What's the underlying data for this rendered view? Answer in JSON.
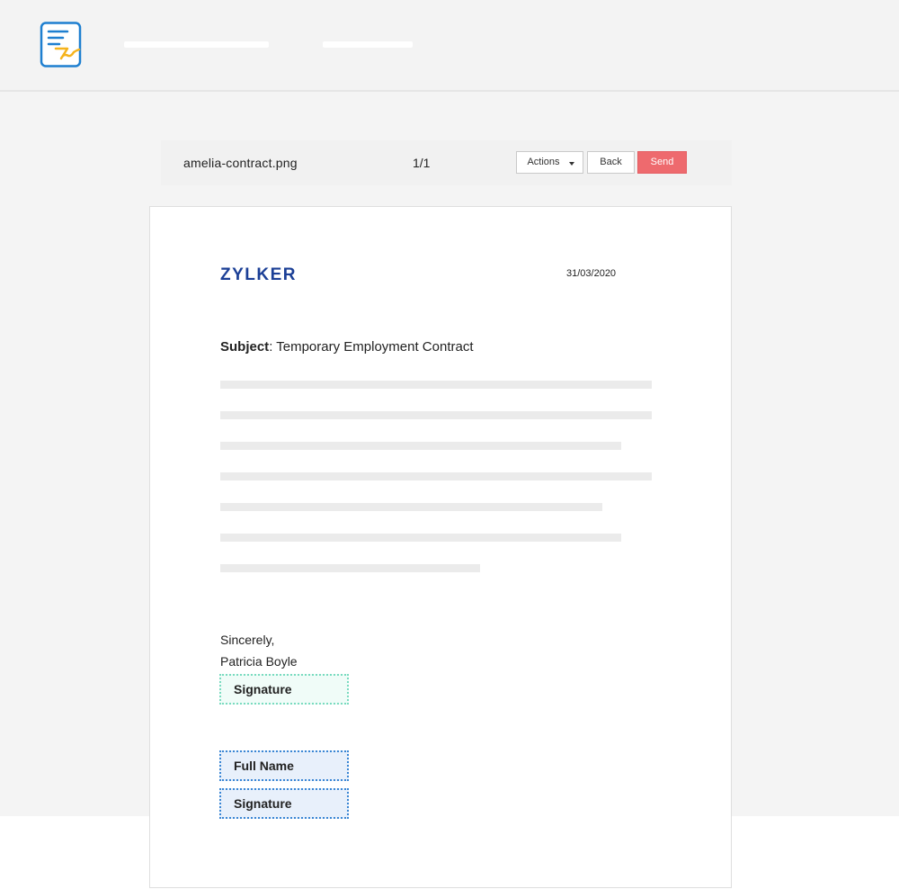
{
  "toolbar": {
    "filename": "amelia-contract.png",
    "page_count": "1/1",
    "actions_label": "Actions",
    "back_label": "Back",
    "send_label": "Send"
  },
  "document": {
    "company": "ZYLKER",
    "date": "31/03/2020",
    "subject_label": "Subject",
    "subject_value": ": Temporary Employment Contract",
    "closing": "Sincerely,",
    "sender_name": "Patricia Boyle"
  },
  "fields": {
    "sender_signature": "Signature",
    "recipient_full_name": "Full Name",
    "recipient_signature": "Signature"
  },
  "icons": {
    "logo": "document-signature-icon",
    "dropdown": "chevron-down-icon"
  },
  "colors": {
    "brand": "#1b3f96",
    "send": "#ee6a6e",
    "logo_blue": "#1e7fd0",
    "logo_gold": "#f5b31c",
    "field_green": "#7adbc0",
    "field_blue": "#3a86d4"
  }
}
